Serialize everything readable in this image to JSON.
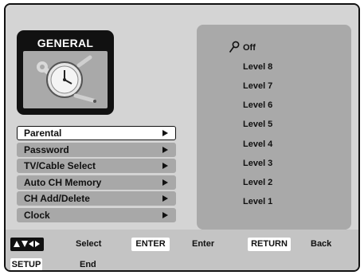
{
  "category": {
    "title": "GENERAL",
    "icon": "clock-wrench-icon"
  },
  "menu": {
    "items": [
      {
        "label": "Parental",
        "selected": true
      },
      {
        "label": "Password",
        "selected": false
      },
      {
        "label": "TV/Cable Select",
        "selected": false
      },
      {
        "label": "Auto CH Memory",
        "selected": false
      },
      {
        "label": "CH Add/Delete",
        "selected": false
      },
      {
        "label": "Clock",
        "selected": false
      }
    ]
  },
  "options": {
    "cursor_icon": "key-icon",
    "items": [
      "Off",
      "Level 8",
      "Level 7",
      "Level 6",
      "Level 5",
      "Level 4",
      "Level 3",
      "Level 2",
      "Level 1"
    ]
  },
  "footer": {
    "nav_keys_icon": "arrow-keys-icon",
    "nav_label": "Select",
    "enter_key": "ENTER",
    "enter_label": "Enter",
    "return_key": "RETURN",
    "return_label": "Back",
    "setup_key": "SETUP",
    "setup_label": "End"
  },
  "colors": {
    "background": "#d4d4d4",
    "panel": "#a9a9a9",
    "highlight": "#ffffff",
    "text": "#111111"
  }
}
